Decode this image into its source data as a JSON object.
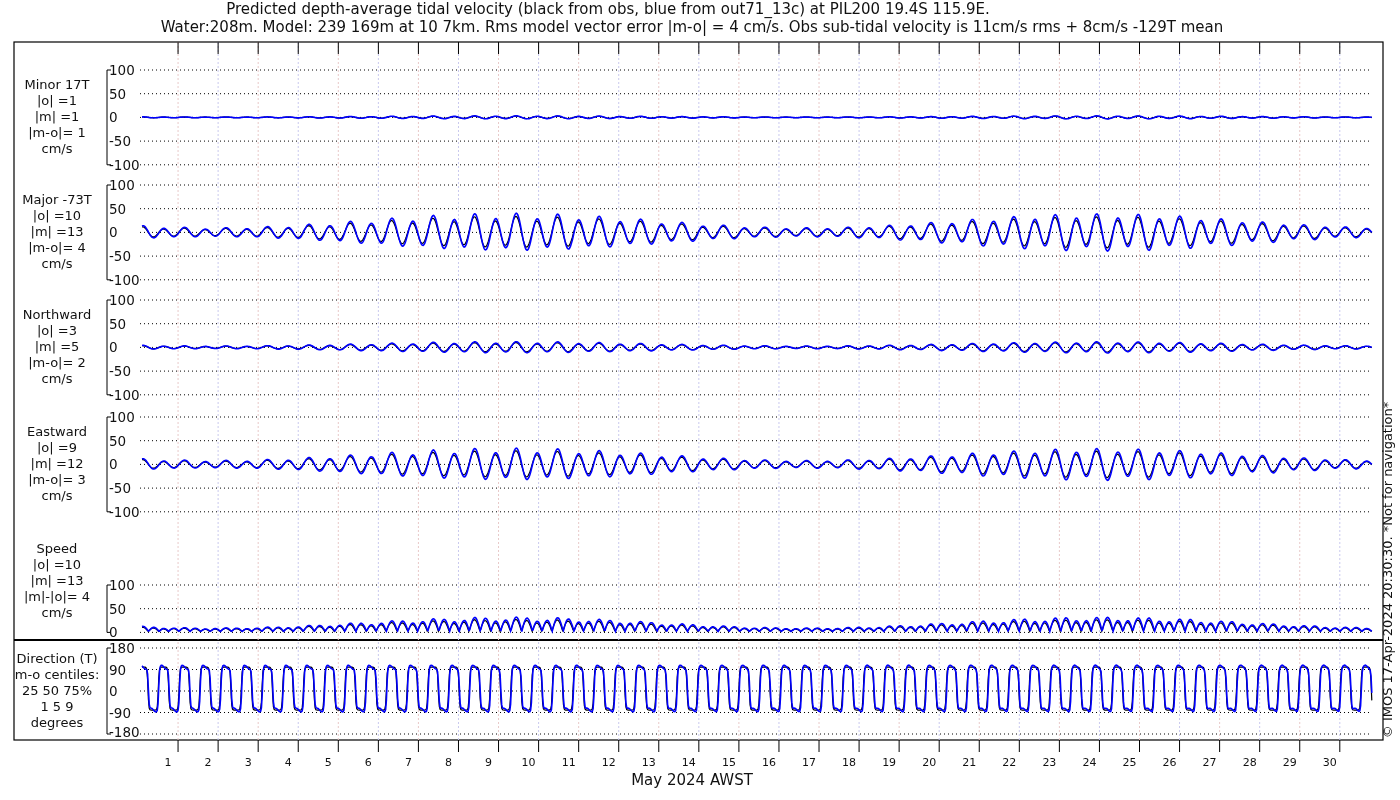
{
  "title_lines": [
    "Predicted depth-average tidal velocity (black from obs, blue from out71_13c) at PIL200 19.4S 115.9E.",
    "Water:208m. Model: 239 169m at 10 7km. Rms model vector error |m-o| = 4 cm/s. Obs sub-tidal velocity is 11cm/s rms + 8cm/s -129T mean"
  ],
  "panels": [
    {
      "kind": "velocity",
      "label_lines": [
        "Minor 17T",
        "|o| =1",
        "|m| =1",
        "|m-o|= 1",
        "cm/s"
      ],
      "yticks": [
        "100",
        "50",
        "0",
        "-50",
        "-100"
      ]
    },
    {
      "kind": "velocity",
      "label_lines": [
        "Major -73T",
        "|o| =10",
        "|m| =13",
        "|m-o|= 4",
        "cm/s"
      ],
      "yticks": [
        "100",
        "50",
        "0",
        "-50",
        "-100"
      ]
    },
    {
      "kind": "velocity",
      "label_lines": [
        "Northward",
        "|o| =3",
        "|m| =5",
        "|m-o|= 2",
        "cm/s"
      ],
      "yticks": [
        "100",
        "50",
        "0",
        "-50",
        "-100"
      ]
    },
    {
      "kind": "velocity",
      "label_lines": [
        "Eastward",
        "|o| =9",
        "|m| =12",
        "|m-o|= 3",
        "cm/s"
      ],
      "yticks": [
        "100",
        "50",
        "0",
        "-50",
        "-100"
      ]
    },
    {
      "kind": "speed",
      "label_lines": [
        "Speed",
        "|o| =10",
        "|m| =13",
        "|m|-|o|= 4",
        "cm/s"
      ],
      "yticks": [
        "100",
        "50",
        "0"
      ]
    },
    {
      "kind": "direction",
      "label_lines": [
        "Direction (T)",
        "m-o centiles:",
        "25  50  75%",
        "1  5  9",
        "degrees"
      ],
      "yticks": [
        "180",
        "90",
        "0",
        "-90",
        "-180"
      ]
    }
  ],
  "x_ticks": [
    "1",
    "2",
    "3",
    "4",
    "5",
    "6",
    "7",
    "8",
    "9",
    "10",
    "11",
    "12",
    "13",
    "14",
    "15",
    "16",
    "17",
    "18",
    "19",
    "20",
    "21",
    "22",
    "23",
    "24",
    "25",
    "26",
    "27",
    "28",
    "29",
    "30"
  ],
  "xlabel": "May 2024 AWST",
  "credit": "© IMOS 17-Apr-2024 20:30:30. *Not for navigation*"
}
